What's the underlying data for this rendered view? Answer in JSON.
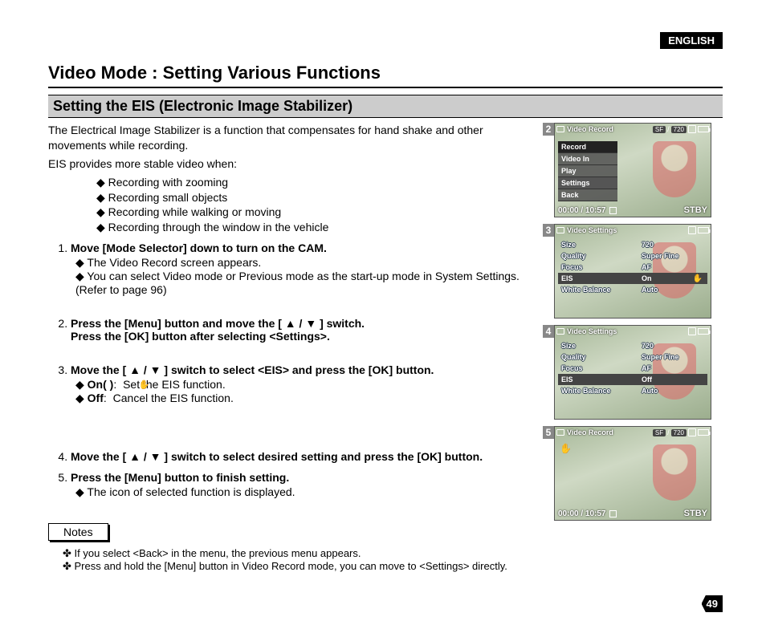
{
  "header": {
    "language": "ENGLISH",
    "title": "Video Mode : Setting Various Functions",
    "subtitle": "Setting the EIS (Electronic Image Stabilizer)"
  },
  "intro": {
    "line1": "The Electrical Image Stabilizer is a function that compensates for hand shake and other movements while recording.",
    "line2": "EIS provides more stable video when:",
    "bullets": [
      "Recording with zooming",
      "Recording small objects",
      "Recording while walking or moving",
      "Recording through the window in the vehicle"
    ]
  },
  "steps": [
    {
      "head": "Move [Mode Selector] down to turn on the CAM.",
      "subs": [
        "The Video Record screen appears.",
        "You can select Video mode or Previous mode as the start-up mode in System Settings. (Refer to page 96)"
      ]
    },
    {
      "head": "Press the [Menu] button and move the [ ▲ / ▼ ] switch.",
      "head2": "Press the [OK] button after selecting <Settings>.",
      "subs": []
    },
    {
      "head": "Move the [ ▲ / ▼ ] switch to select <EIS> and press the [OK] button.",
      "subs": [],
      "opts": [
        {
          "label": "On(      )",
          "colon": ":",
          "desc": "Set the EIS function."
        },
        {
          "label": "Off",
          "colon": ":",
          "desc": "Cancel the EIS function."
        }
      ]
    },
    {
      "head": "Move the [ ▲ / ▼ ] switch to select desired setting and press the [OK] button.",
      "subs": []
    },
    {
      "head": "Press the [Menu] button to finish setting.",
      "subs": [
        "The icon of selected function is displayed."
      ]
    }
  ],
  "notes": {
    "label": "Notes",
    "items": [
      "If you select <Back> in the menu, the previous menu appears.",
      "Press and hold the [Menu] button in Video Record mode, you can move to <Settings> directly."
    ]
  },
  "screens": {
    "s2": {
      "num": "2",
      "mode": "Video Record",
      "badges": {
        "sf": "SF",
        "sep": "/",
        "res": "720"
      },
      "menu": [
        "Record",
        "Video In",
        "Play",
        "Settings",
        "Back"
      ],
      "selected": "Settings",
      "time": "00:00 / 10:57",
      "stby": "STBY"
    },
    "s3": {
      "num": "3",
      "mode": "Video Settings",
      "rows": [
        {
          "l": "Size",
          "v": "720"
        },
        {
          "l": "Quality",
          "v": "Super Fine"
        },
        {
          "l": "Focus",
          "v": "AF"
        },
        {
          "l": "EIS",
          "v": "On",
          "sel": true,
          "hand": true
        },
        {
          "l": "White Balance",
          "v": "Auto"
        }
      ]
    },
    "s4": {
      "num": "4",
      "mode": "Video Settings",
      "rows": [
        {
          "l": "Size",
          "v": "720"
        },
        {
          "l": "Quality",
          "v": "Super Fine"
        },
        {
          "l": "Focus",
          "v": "AF"
        },
        {
          "l": "EIS",
          "v": "Off",
          "sel": true
        },
        {
          "l": "White Balance",
          "v": "Auto"
        }
      ]
    },
    "s5": {
      "num": "5",
      "mode": "Video Record",
      "badges": {
        "sf": "SF",
        "sep": "/",
        "res": "720"
      },
      "time": "00:00 / 10:57",
      "stby": "STBY"
    }
  },
  "pagenum": "49"
}
